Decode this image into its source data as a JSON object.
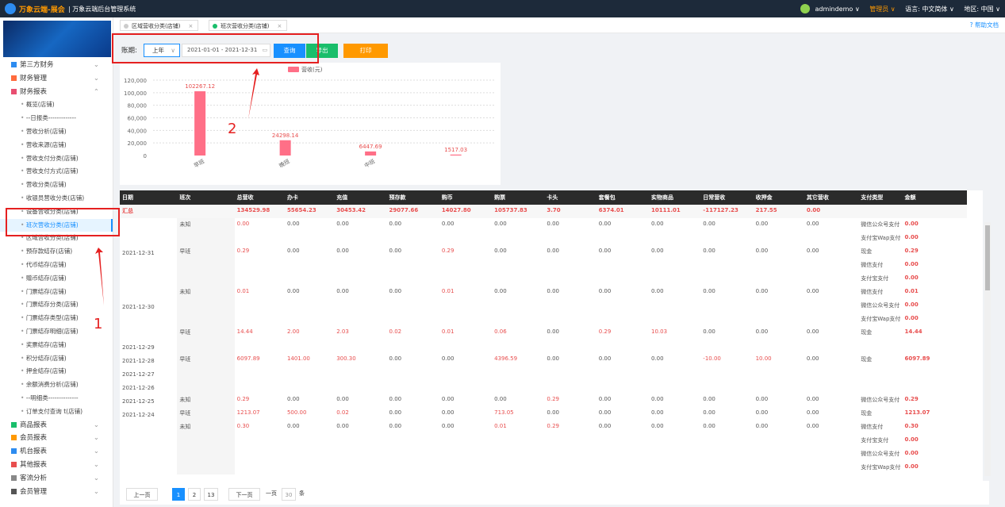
{
  "topbar": {
    "brand": "万象云端-展会",
    "system": "| 万象云端后台管理系统",
    "user": "admindemo ∨",
    "role": "管理员 ∨",
    "lang": "语言: 中文简体 ∨",
    "region": "地区: 中国 ∨"
  },
  "sidebar": {
    "groups_top": [
      {
        "label": "第三方财务",
        "color": "#2d8cf0"
      },
      {
        "label": "财务管理",
        "color": "#ff6b3d"
      },
      {
        "label": "财务报表",
        "color": "#e84e70"
      }
    ],
    "sub_items": [
      "概览(店铺)",
      "--日报类-------------",
      "营收分析(店铺)",
      "营收来源(店铺)",
      "营收支付分类(店铺)",
      "营收支付方式(店铺)",
      "营收分类(店铺)",
      "收银员营收分类(店铺)",
      "设备营收分类(店铺)",
      "班次营收分类(店铺)",
      "区域营收分类(店铺)",
      "预存款结存(店铺)",
      "代币结存(店铺)",
      "赠币结存(店铺)",
      "门票结存(店铺)",
      "门票结存分类(店铺)",
      "门票结存类型(店铺)",
      "门票结存明细(店铺)",
      "奖票结存(店铺)",
      "积分结存(店铺)",
      "押金结存(店铺)",
      "余额消费分析(店铺)",
      "--明细类--------------",
      "订单支付查询 t(店铺)"
    ],
    "groups_bottom": [
      {
        "label": "商品报表",
        "color": "#19be6b"
      },
      {
        "label": "会员报表",
        "color": "#ff9900"
      },
      {
        "label": "机台报表",
        "color": "#2d8cf0"
      },
      {
        "label": "其他报表",
        "color": "#e84e4e"
      },
      {
        "label": "客流分析",
        "color": "#888"
      },
      {
        "label": "会员管理",
        "color": "#555"
      }
    ]
  },
  "tabs": [
    {
      "label": "区域营收分类(店铺)"
    },
    {
      "label": "班次营收分类(店铺)"
    }
  ],
  "help": "帮助文档",
  "toolbar": {
    "period_label": "账期:",
    "period_value": "上年",
    "period_chevron": "∨",
    "date_range": "2021-01-01 - 2021-12-31",
    "query": "查询",
    "export": "导出",
    "print": "打印"
  },
  "annotations": {
    "n1": "1",
    "n2": "2"
  },
  "chart_data": {
    "type": "bar",
    "legend": "营收(元)",
    "categories": [
      "早班",
      "晚班",
      "中班",
      ""
    ],
    "values": [
      102267.12,
      24298.14,
      6447.69,
      1517.03
    ],
    "value_labels": [
      "102267.12",
      "24298.14",
      "6447.69",
      "1517.03"
    ],
    "ylim": [
      0,
      120000
    ],
    "yticks": [
      "120,000",
      "100,000",
      "80,000",
      "60,000",
      "40,000",
      "20,000",
      "0"
    ],
    "color": "#ff6f87"
  },
  "table": {
    "headers": [
      "日期",
      "班次",
      "总营收",
      "办卡",
      "充值",
      "预存款",
      "购币",
      "购票",
      "卡头",
      "套餐包",
      "实物商品",
      "日常营收",
      "收押金",
      "其它营收",
      "支付类型",
      "金额"
    ],
    "summary": [
      "汇总",
      "",
      "134529.98",
      "55654.23",
      "30453.42",
      "29077.66",
      "14027.80",
      "105737.83",
      "3.70",
      "6374.01",
      "10111.01",
      "-117127.23",
      "217.55",
      "0.00",
      "",
      ""
    ],
    "rows": [
      [
        "",
        "未知",
        "0.00",
        "0.00",
        "0.00",
        "0.00",
        "0.00",
        "0.00",
        "0.00",
        "0.00",
        "0.00",
        "0.00",
        "0.00",
        "0.00",
        "微信公众号支付",
        "0.00"
      ],
      [
        "",
        "",
        "",
        "",
        "",
        "",
        "",
        "",
        "",
        "",
        "",
        "",
        "",
        "",
        "支付宝Wap支付",
        "0.00"
      ],
      [
        "2021-12-31",
        "早班",
        "0.29",
        "0.00",
        "0.00",
        "0.00",
        "0.29",
        "0.00",
        "0.00",
        "0.00",
        "0.00",
        "0.00",
        "0.00",
        "0.00",
        "现金",
        "0.29"
      ],
      [
        "",
        "",
        "",
        "",
        "",
        "",
        "",
        "",
        "",
        "",
        "",
        "",
        "",
        "",
        "微信支付",
        "0.00"
      ],
      [
        "",
        "",
        "",
        "",
        "",
        "",
        "",
        "",
        "",
        "",
        "",
        "",
        "",
        "",
        "支付宝支付",
        "0.00"
      ],
      [
        "",
        "未知",
        "0.01",
        "0.00",
        "0.00",
        "0.00",
        "0.01",
        "0.00",
        "0.00",
        "0.00",
        "0.00",
        "0.00",
        "0.00",
        "0.00",
        "微信支付",
        "0.01"
      ],
      [
        "2021-12-30",
        "",
        "",
        "",
        "",
        "",
        "",
        "",
        "",
        "",
        "",
        "",
        "",
        "",
        "微信公众号支付",
        "0.00"
      ],
      [
        "",
        "",
        "",
        "",
        "",
        "",
        "",
        "",
        "",
        "",
        "",
        "",
        "",
        "",
        "支付宝Wap支付",
        "0.00"
      ],
      [
        "",
        "早班",
        "14.44",
        "2.00",
        "2.03",
        "0.02",
        "0.01",
        "0.06",
        "0.00",
        "0.29",
        "10.03",
        "0.00",
        "0.00",
        "0.00",
        "现金",
        "14.44"
      ],
      [
        "2021-12-29",
        "",
        "",
        "",
        "",
        "",
        "",
        "",
        "",
        "",
        "",
        "",
        "",
        "",
        "",
        ""
      ],
      [
        "2021-12-28",
        "早班",
        "6097.89",
        "1401.00",
        "300.30",
        "0.00",
        "0.00",
        "4396.59",
        "0.00",
        "0.00",
        "0.00",
        "-10.00",
        "10.00",
        "0.00",
        "现金",
        "6097.89"
      ],
      [
        "2021-12-27",
        "",
        "",
        "",
        "",
        "",
        "",
        "",
        "",
        "",
        "",
        "",
        "",
        "",
        "",
        ""
      ],
      [
        "2021-12-26",
        "",
        "",
        "",
        "",
        "",
        "",
        "",
        "",
        "",
        "",
        "",
        "",
        "",
        "",
        ""
      ],
      [
        "2021-12-25",
        "未知",
        "0.29",
        "0.00",
        "0.00",
        "0.00",
        "0.00",
        "0.00",
        "0.29",
        "0.00",
        "0.00",
        "0.00",
        "0.00",
        "0.00",
        "微信公众号支付",
        "0.29"
      ],
      [
        "2021-12-24",
        "早班",
        "1213.07",
        "500.00",
        "0.02",
        "0.00",
        "0.00",
        "713.05",
        "0.00",
        "0.00",
        "0.00",
        "0.00",
        "0.00",
        "0.00",
        "现金",
        "1213.07"
      ],
      [
        "",
        "未知",
        "0.30",
        "0.00",
        "0.00",
        "0.00",
        "0.00",
        "0.01",
        "0.29",
        "0.00",
        "0.00",
        "0.00",
        "0.00",
        "0.00",
        "微信支付",
        "0.30"
      ],
      [
        "",
        "",
        "",
        "",
        "",
        "",
        "",
        "",
        "",
        "",
        "",
        "",
        "",
        "",
        "支付宝支付",
        "0.00"
      ],
      [
        "",
        "",
        "",
        "",
        "",
        "",
        "",
        "",
        "",
        "",
        "",
        "",
        "",
        "",
        "微信公众号支付",
        "0.00"
      ],
      [
        "",
        "",
        "",
        "",
        "",
        "",
        "",
        "",
        "",
        "",
        "",
        "",
        "",
        "",
        "支付宝Wap支付",
        "0.00"
      ]
    ]
  },
  "pager": {
    "prev": "上一页",
    "pages": [
      "1",
      "2",
      "13"
    ],
    "next": "下一页",
    "per_page_label": "一页",
    "per_page": "30",
    "unit": "条"
  }
}
